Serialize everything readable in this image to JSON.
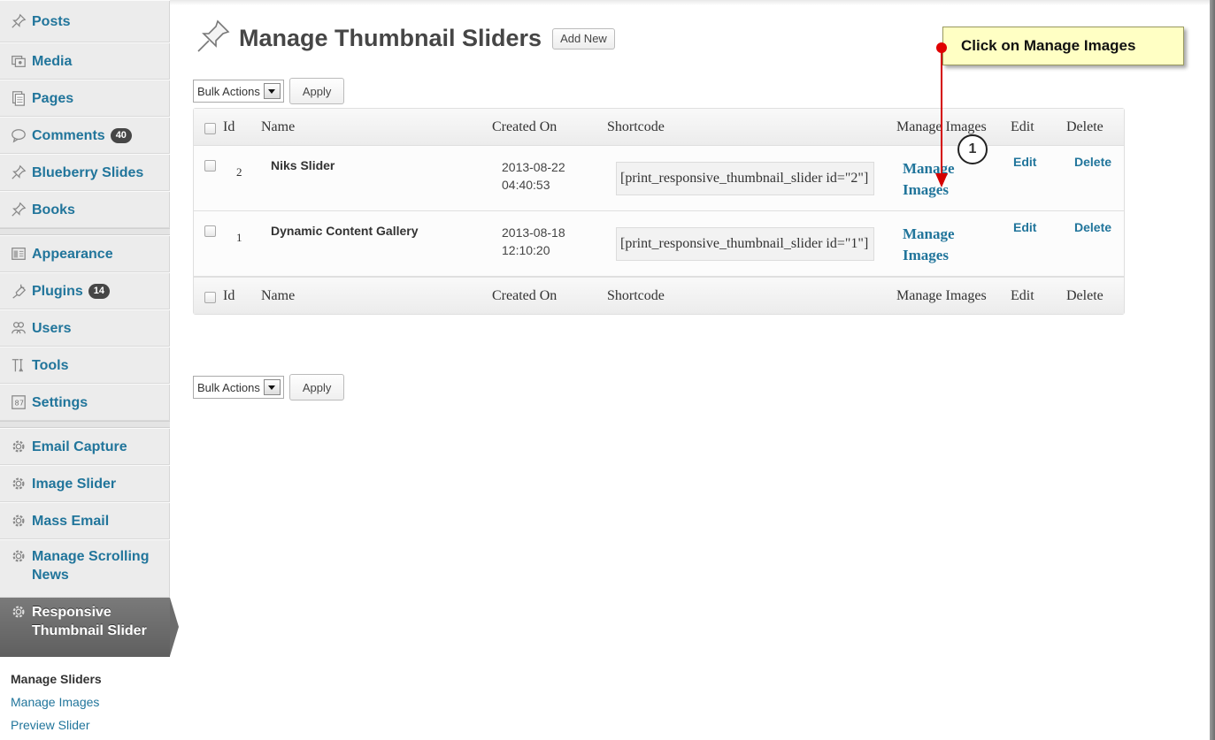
{
  "sidebar": {
    "items": [
      {
        "label": "Posts",
        "icon": "pin-icon"
      },
      {
        "label": "Media",
        "icon": "media-icon"
      },
      {
        "label": "Pages",
        "icon": "pages-icon"
      },
      {
        "label": "Comments",
        "icon": "comments-icon",
        "badge": "40"
      },
      {
        "label": "Blueberry Slides",
        "icon": "pin-icon"
      },
      {
        "label": "Books",
        "icon": "pin-icon"
      },
      {
        "label": "Appearance",
        "icon": "appearance-icon"
      },
      {
        "label": "Plugins",
        "icon": "plugins-icon",
        "badge": "14"
      },
      {
        "label": "Users",
        "icon": "users-icon"
      },
      {
        "label": "Tools",
        "icon": "tools-icon"
      },
      {
        "label": "Settings",
        "icon": "settings-icon"
      },
      {
        "label": "Email Capture",
        "icon": "gear-icon"
      },
      {
        "label": "Image Slider",
        "icon": "gear-icon"
      },
      {
        "label": "Mass Email",
        "icon": "gear-icon"
      },
      {
        "label_line1": "Manage Scrolling",
        "label_line2": "News",
        "icon": "gear-icon"
      },
      {
        "label_line1": "Responsive",
        "label_line2": "Thumbnail Slider",
        "icon": "gear-icon",
        "active": true
      }
    ],
    "submenu": [
      "Manage Sliders",
      "Manage Images",
      "Preview Slider"
    ]
  },
  "header": {
    "title": "Manage Thumbnail Sliders",
    "add_new": "Add New"
  },
  "bulk": {
    "selected": "Bulk Actions",
    "apply": "Apply"
  },
  "table": {
    "columns": [
      "Id",
      "Name",
      "Created On",
      "Shortcode",
      "Manage Images",
      "Edit",
      "Delete"
    ],
    "rows": [
      {
        "id": "2",
        "name": "Niks Slider",
        "date": "2013-08-22",
        "time": "04:40:53",
        "shortcode": "[print_responsive_thumbnail_slider id=\"2\"]",
        "manage_line1": "Manage",
        "manage_line2": "Images",
        "edit": "Edit",
        "delete": "Delete"
      },
      {
        "id": "1",
        "name": "Dynamic Content Gallery",
        "date": "2013-08-18",
        "time": "12:10:20",
        "shortcode": "[print_responsive_thumbnail_slider id=\"1\"]",
        "manage_line1": "Manage",
        "manage_line2": "Images",
        "edit": "Edit",
        "delete": "Delete"
      }
    ]
  },
  "annotation": {
    "callout": "Click on Manage Images",
    "step": "1"
  },
  "colors": {
    "link": "#21759b",
    "sidebar_bg": "#ececec",
    "active_bg": "#6c6c6c",
    "callout_bg": "#ffffc4",
    "arrow": "#d40000"
  }
}
